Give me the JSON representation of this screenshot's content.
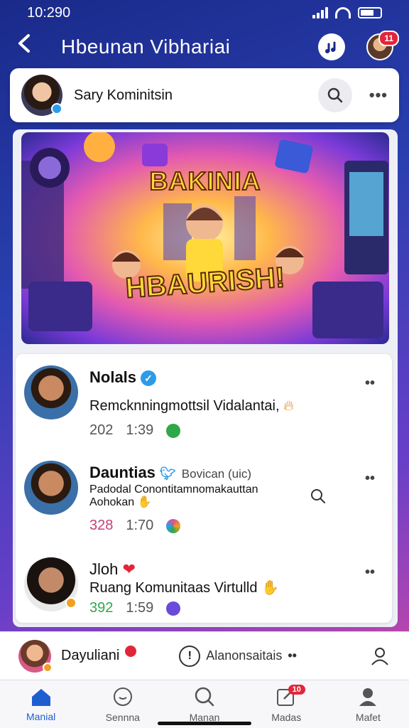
{
  "status_bar": {
    "time": "10:290"
  },
  "header": {
    "title": "Hbeunan Vibhariai",
    "notification_count": "11"
  },
  "profile_card": {
    "name": "Sary Kominitsin"
  },
  "banner": {
    "line1": "BAKINIA",
    "line2": "HBAURISH!"
  },
  "posts": [
    {
      "author": "Nolals",
      "subtitle": "",
      "text": "Remcknningmottsil Vidalantai,",
      "count": "202",
      "time": "1:39",
      "icon_color": "#2fa84a"
    },
    {
      "author": "Dauntias",
      "subtitle": "Bovican (uic)",
      "text": "Padodal Conontitamnomakauttan Aohokan",
      "count": "328",
      "time": "1:70",
      "icon_color": "#e0508a"
    },
    {
      "author": "Jloh",
      "subtitle": "",
      "text": "Ruang Komunitaas Virtulld",
      "count": "392",
      "time": "1:59",
      "icon_color": "#6a4ad8"
    }
  ],
  "compose": {
    "name": "Dayuliani",
    "label": "Alanonsaitais"
  },
  "tabs": [
    {
      "label": "Manial",
      "icon": "home-icon",
      "active": true
    },
    {
      "label": "Sennna",
      "icon": "chat-icon",
      "active": false
    },
    {
      "label": "Manan",
      "icon": "search-icon",
      "active": false
    },
    {
      "label": "Madas",
      "icon": "edit-icon",
      "active": false,
      "badge": "10"
    },
    {
      "label": "Mafet",
      "icon": "profile-icon",
      "active": false
    }
  ]
}
